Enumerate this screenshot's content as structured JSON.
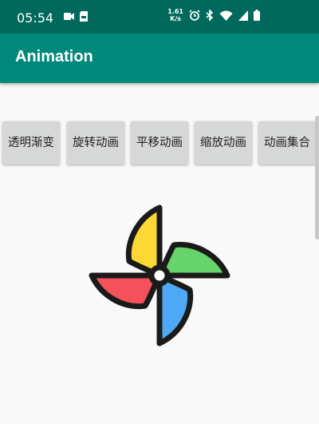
{
  "status_bar": {
    "time": "05:54",
    "speed_value": "1.61",
    "speed_unit": "K/s",
    "icons": [
      "video-icon",
      "sd-card-icon",
      "alarm-icon",
      "bluetooth-icon",
      "wifi-icon",
      "signal-icon",
      "battery-icon"
    ]
  },
  "app_bar": {
    "title": "Animation"
  },
  "buttons": [
    {
      "label": "透明渐变"
    },
    {
      "label": "旋转动画"
    },
    {
      "label": "平移动画"
    },
    {
      "label": "缩放动画"
    },
    {
      "label": "动画集合"
    }
  ],
  "colors": {
    "status_bar": "#00695c",
    "app_bar": "#00897b",
    "button_bg": "#d6d7d7",
    "blade_yellow": "#fdd835",
    "blade_green": "#66d46a",
    "blade_red": "#f4515a",
    "blade_blue": "#4fa8f5"
  }
}
